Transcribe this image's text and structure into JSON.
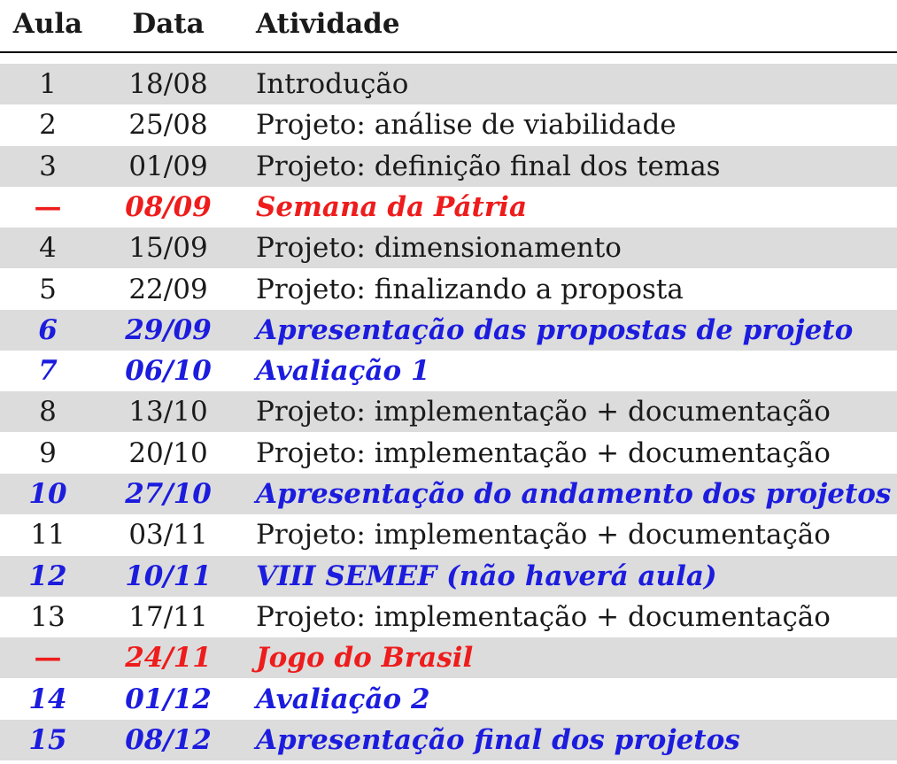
{
  "headers": {
    "aula": "Aula",
    "data": "Data",
    "atividade": "Atividade"
  },
  "colors": {
    "shade": "#dcdcdc",
    "holiday": "#ee1c1c",
    "event": "#1c1cde",
    "normal": "#1a1a1a"
  },
  "rows": [
    {
      "aula": "1",
      "data": "18/08",
      "atividade": "Introdução",
      "kind": "normal",
      "shaded": true
    },
    {
      "aula": "2",
      "data": "25/08",
      "atividade": "Projeto: análise de viabilidade",
      "kind": "normal",
      "shaded": false
    },
    {
      "aula": "3",
      "data": "01/09",
      "atividade": "Projeto: definição final dos temas",
      "kind": "normal",
      "shaded": true
    },
    {
      "aula": "—",
      "data": "08/09",
      "atividade": "Semana da Pátria",
      "kind": "holiday",
      "shaded": false
    },
    {
      "aula": "4",
      "data": "15/09",
      "atividade": "Projeto: dimensionamento",
      "kind": "normal",
      "shaded": true
    },
    {
      "aula": "5",
      "data": "22/09",
      "atividade": "Projeto: finalizando a proposta",
      "kind": "normal",
      "shaded": false
    },
    {
      "aula": "6",
      "data": "29/09",
      "atividade": "Apresentação das propostas de projeto",
      "kind": "event",
      "shaded": true
    },
    {
      "aula": "7",
      "data": "06/10",
      "atividade": "Avaliação 1",
      "kind": "event",
      "shaded": false
    },
    {
      "aula": "8",
      "data": "13/10",
      "atividade": "Projeto: implementação + documentação",
      "kind": "normal",
      "shaded": true
    },
    {
      "aula": "9",
      "data": "20/10",
      "atividade": "Projeto: implementação + documentação",
      "kind": "normal",
      "shaded": false
    },
    {
      "aula": "10",
      "data": "27/10",
      "atividade": "Apresentação do andamento dos projetos",
      "kind": "event",
      "shaded": true
    },
    {
      "aula": "11",
      "data": "03/11",
      "atividade": "Projeto: implementação + documentação",
      "kind": "normal",
      "shaded": false
    },
    {
      "aula": "12",
      "data": "10/11",
      "atividade": "VIII SEMEF (não haverá aula)",
      "kind": "event",
      "shaded": true
    },
    {
      "aula": "13",
      "data": "17/11",
      "atividade": "Projeto: implementação + documentação",
      "kind": "normal",
      "shaded": false
    },
    {
      "aula": "—",
      "data": "24/11",
      "atividade": "Jogo do Brasil",
      "kind": "holiday",
      "shaded": true
    },
    {
      "aula": "14",
      "data": "01/12",
      "atividade": "Avaliação 2",
      "kind": "event",
      "shaded": false
    },
    {
      "aula": "15",
      "data": "08/12",
      "atividade": "Apresentação final dos projetos",
      "kind": "event",
      "shaded": true
    }
  ]
}
